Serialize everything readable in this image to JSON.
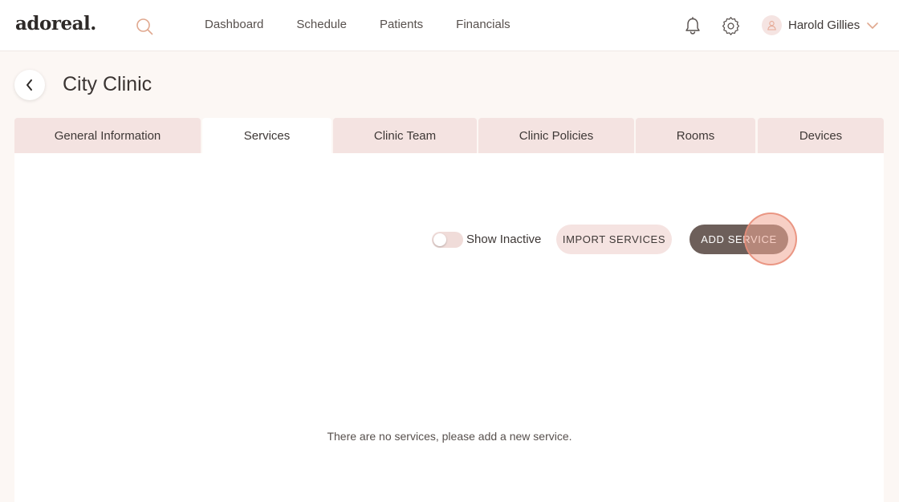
{
  "header": {
    "logo": "adoreal.",
    "nav": [
      "Dashboard",
      "Schedule",
      "Patients",
      "Financials"
    ],
    "user_name": "Harold Gillies"
  },
  "page": {
    "title": "City Clinic"
  },
  "tabs": [
    {
      "label": "General Information"
    },
    {
      "label": "Services",
      "active": true
    },
    {
      "label": "Clinic Team"
    },
    {
      "label": "Clinic Policies"
    },
    {
      "label": "Rooms"
    },
    {
      "label": "Devices"
    }
  ],
  "services": {
    "show_inactive_label": "Show Inactive",
    "show_inactive_on": false,
    "import_label": "IMPORT SERVICES",
    "add_label": "ADD SERVICE",
    "empty_message": "There are no services, please add a new service."
  },
  "colors": {
    "accent": "#e6a995",
    "primary_button": "#6d5f5a",
    "tab_background": "#f4e3e1",
    "page_background": "#fcf7f4"
  },
  "icons": [
    "search-icon",
    "bell-icon",
    "gear-icon",
    "user-icon",
    "chevron-down-icon",
    "chevron-left-icon"
  ]
}
